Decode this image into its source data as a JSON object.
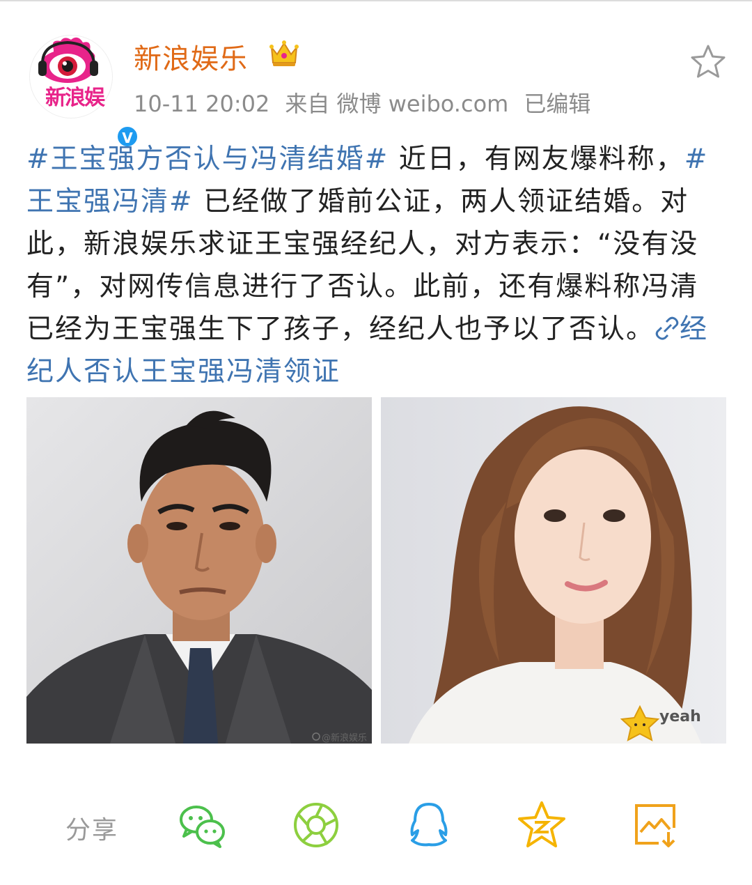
{
  "post": {
    "account": {
      "name": "新浪娱乐",
      "avatar_text": "新浪娱",
      "verified_mark": "V"
    },
    "meta": {
      "timestamp": "10-11 20:02",
      "source": "来自 微博 weibo.com",
      "edited": "已编辑"
    },
    "text": {
      "tag1": "#王宝强方否认与冯清结婚#",
      "seg1": " 近日，有网友爆料称，",
      "tag2": "#王宝强冯清#",
      "seg2": " 已经做了婚前公证，两人领证结婚。对此，新浪娱乐求证王宝强经纪人，对方表示：“没有没有”，对网传信息进行了否认。此前，还有爆料称冯清已经为王宝强生下了孩子，经纪人也予以了否认。",
      "link_text": "经纪人否认王宝强冯清领证"
    },
    "photos": {
      "left_watermark": "@新浪娱乐",
      "right_sticker": "yeah"
    }
  },
  "share_bar": {
    "label": "分享",
    "icons": [
      "wechat-icon",
      "moments-icon",
      "qq-icon",
      "qzone-icon",
      "save-image-icon"
    ]
  },
  "colors": {
    "account_name": "#e06a17",
    "hashtag": "#3f74b1",
    "meta": "#8b8b8b",
    "share_green": "#4cc04c",
    "share_blue": "#2a9ee6",
    "share_yellow": "#f5b400",
    "share_orange": "#f0a21b"
  }
}
